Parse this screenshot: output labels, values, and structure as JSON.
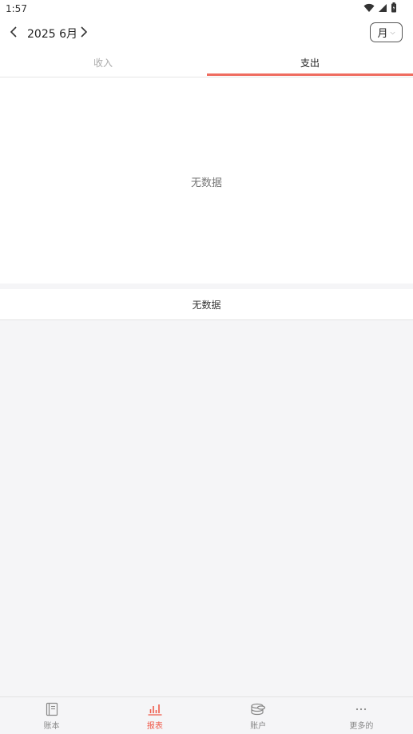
{
  "status_bar": {
    "time": "1:57"
  },
  "header": {
    "month_label": "2025 6月",
    "period_button": "月"
  },
  "tabs": [
    {
      "label": "收入",
      "active": false
    },
    {
      "label": "支出",
      "active": true
    }
  ],
  "chart": {
    "empty_text": "无数据"
  },
  "list": {
    "empty_text": "无数据"
  },
  "bottom_nav": {
    "items": [
      {
        "label": "账本",
        "icon": "book-icon"
      },
      {
        "label": "报表",
        "icon": "bar-chart-icon",
        "active": true
      },
      {
        "label": "账户",
        "icon": "coins-icon"
      },
      {
        "label": "更多的",
        "icon": "more-icon"
      }
    ]
  },
  "colors": {
    "accent": "#ef6c5f",
    "active_nav": "#ef5a4a"
  }
}
